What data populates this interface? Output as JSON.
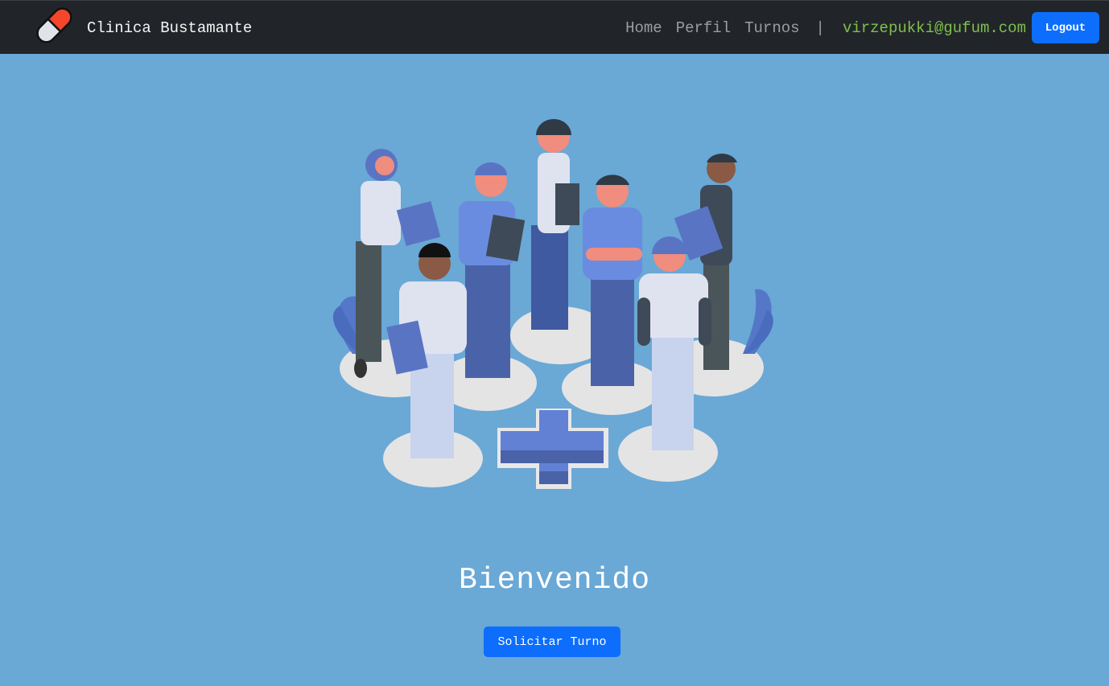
{
  "brand": {
    "name": "Clinica Bustamante",
    "logo_icon": "pill-capsule-icon"
  },
  "nav": {
    "links": [
      "Home",
      "Perfil",
      "Turnos"
    ],
    "separator": "|",
    "user_email": "virzepukki@gufum.com",
    "logout_label": "Logout"
  },
  "main": {
    "illustration": "medical-team-illustration",
    "welcome": "Bienvenido",
    "cta_label": "Solicitar Turno"
  },
  "colors": {
    "navbar_bg": "#212529",
    "page_bg": "#6aa8d6",
    "primary": "#0d6efd",
    "email": "#7fc04a"
  }
}
